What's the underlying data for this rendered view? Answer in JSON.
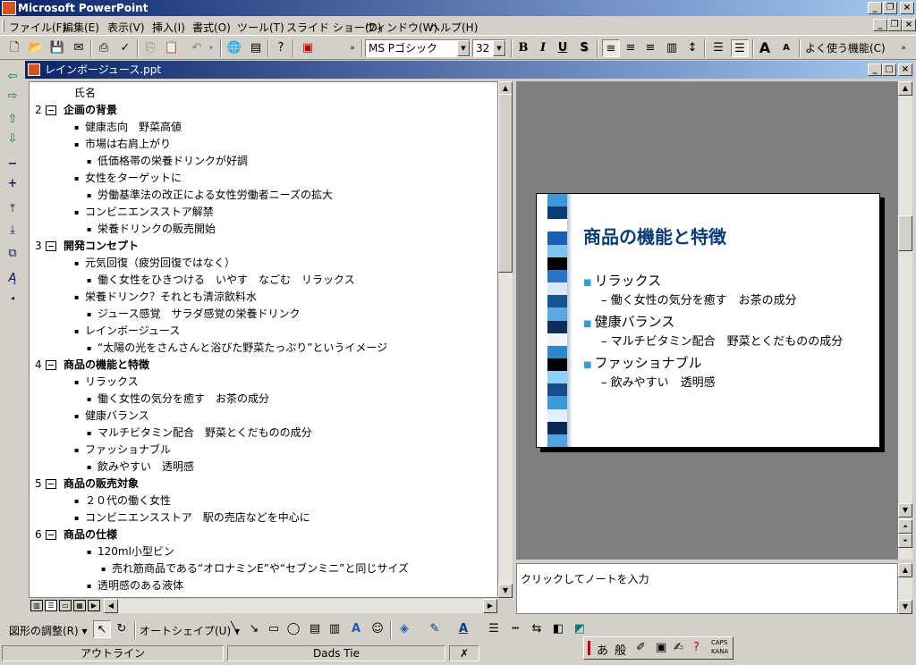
{
  "app_title": "Microsoft PowerPoint",
  "menu": [
    "ファイル(F)",
    "編集(E)",
    "表示(V)",
    "挿入(I)",
    "書式(O)",
    "ツール(T)",
    "スライド ショー(D)",
    "ウィンドウ(W)",
    "ヘルプ(H)"
  ],
  "toolbar": {
    "font": "MS Pゴシック",
    "size": "32",
    "bold": "B",
    "italic": "I",
    "underline": "U",
    "shadow": "S",
    "grow_font": "A",
    "shrink_font": "A",
    "frequent": "よく使う機能(C) ▾"
  },
  "document": {
    "title": "レインボージュース.ppt"
  },
  "outline": [
    {
      "type": "text",
      "level": 1,
      "text": "氏名"
    },
    {
      "type": "title",
      "num": "2",
      "text": "企画の背景"
    },
    {
      "type": "bullet",
      "level": 1,
      "text": "健康志向　野菜高値"
    },
    {
      "type": "bullet",
      "level": 1,
      "text": "市場は右肩上がり"
    },
    {
      "type": "bullet",
      "level": 2,
      "text": "低価格帯の栄養ドリンクが好調"
    },
    {
      "type": "bullet",
      "level": 1,
      "text": "女性をターゲットに"
    },
    {
      "type": "bullet",
      "level": 2,
      "text": "労働基準法の改正による女性労働者ニーズの拡大"
    },
    {
      "type": "bullet",
      "level": 1,
      "text": "コンビニエンスストア解禁"
    },
    {
      "type": "bullet",
      "level": 2,
      "text": "栄養ドリンクの販売開始"
    },
    {
      "type": "title",
      "num": "3",
      "text": "開発コンセプト"
    },
    {
      "type": "bullet",
      "level": 1,
      "text": "元気回復（疲労回復ではなく）"
    },
    {
      "type": "bullet",
      "level": 2,
      "text": "働く女性をひきつける　いやす　なごむ　リラックス"
    },
    {
      "type": "bullet",
      "level": 1,
      "text": "栄養ドリンク？それとも清涼飲料水"
    },
    {
      "type": "bullet",
      "level": 2,
      "text": "ジュース感覚　サラダ感覚の栄養ドリンク"
    },
    {
      "type": "bullet",
      "level": 1,
      "text": "レインボージュース"
    },
    {
      "type": "bullet",
      "level": 2,
      "text": "“太陽の光をさんさんと浴びた野菜たっぷり”というイメージ"
    },
    {
      "type": "title",
      "num": "4",
      "text": "商品の機能と特徴"
    },
    {
      "type": "bullet",
      "level": 1,
      "text": "リラックス"
    },
    {
      "type": "bullet",
      "level": 2,
      "text": "働く女性の気分を癒す　お茶の成分"
    },
    {
      "type": "bullet",
      "level": 1,
      "text": "健康バランス"
    },
    {
      "type": "bullet",
      "level": 2,
      "text": "マルチビタミン配合　野菜とくだものの成分"
    },
    {
      "type": "bullet",
      "level": 1,
      "text": "ファッショナブル"
    },
    {
      "type": "bullet",
      "level": 2,
      "text": "飲みやすい　透明感"
    },
    {
      "type": "title",
      "num": "5",
      "text": "商品の販売対象"
    },
    {
      "type": "bullet",
      "level": 1,
      "text": "２０代の働く女性"
    },
    {
      "type": "bullet",
      "level": 1,
      "text": "コンビニエンスストア　駅の売店などを中心に"
    },
    {
      "type": "title",
      "num": "6",
      "text": "商品の仕様"
    },
    {
      "type": "bullet",
      "level": 2,
      "text": "120ml小型ビン"
    },
    {
      "type": "bullet",
      "level": 3,
      "text": "売れ筋商品である“オロナミンE”や“セブンミニ”と同じサイズ"
    },
    {
      "type": "bullet",
      "level": 2,
      "text": "透明感のある液体"
    }
  ],
  "slide": {
    "title": "商品の機能と特徴",
    "items": [
      {
        "level": 1,
        "text": "リラックス"
      },
      {
        "level": 2,
        "text": "働く女性の気分を癒す　お茶の成分"
      },
      {
        "level": 1,
        "text": "健康バランス"
      },
      {
        "level": 2,
        "text": "マルチビタミン配合　野菜とくだものの成分"
      },
      {
        "level": 1,
        "text": "ファッショナブル"
      },
      {
        "level": 2,
        "text": "飲みやすい　透明感"
      }
    ],
    "stripe_colors": [
      "#3a9ad9",
      "#0a3d78",
      "#ffffff",
      "#1a5fb4",
      "#7cc4ee",
      "#000000",
      "#2a74c8",
      "#d8e8f6",
      "#14548f",
      "#5aa8e2",
      "#0c2f5a",
      "#eef5fb",
      "#2f86cc",
      "#000000",
      "#8fd0f4",
      "#174e8a",
      "#3a9ad9",
      "#e0f0ff",
      "#082a52",
      "#4ea3e0"
    ],
    "title_color": "#0a3d78",
    "bullet_color": "#3a9ad9"
  },
  "notes": {
    "placeholder": "クリックしてノートを入力"
  },
  "drawing": {
    "adjust": "図形の調整(R) ▾",
    "autoshape": "オートシェイプ(U) ▾"
  },
  "status": {
    "view": "アウトライン",
    "design": "Dads Tie"
  },
  "ime": [
    "あ",
    "般",
    "CAPS",
    "KANA"
  ]
}
